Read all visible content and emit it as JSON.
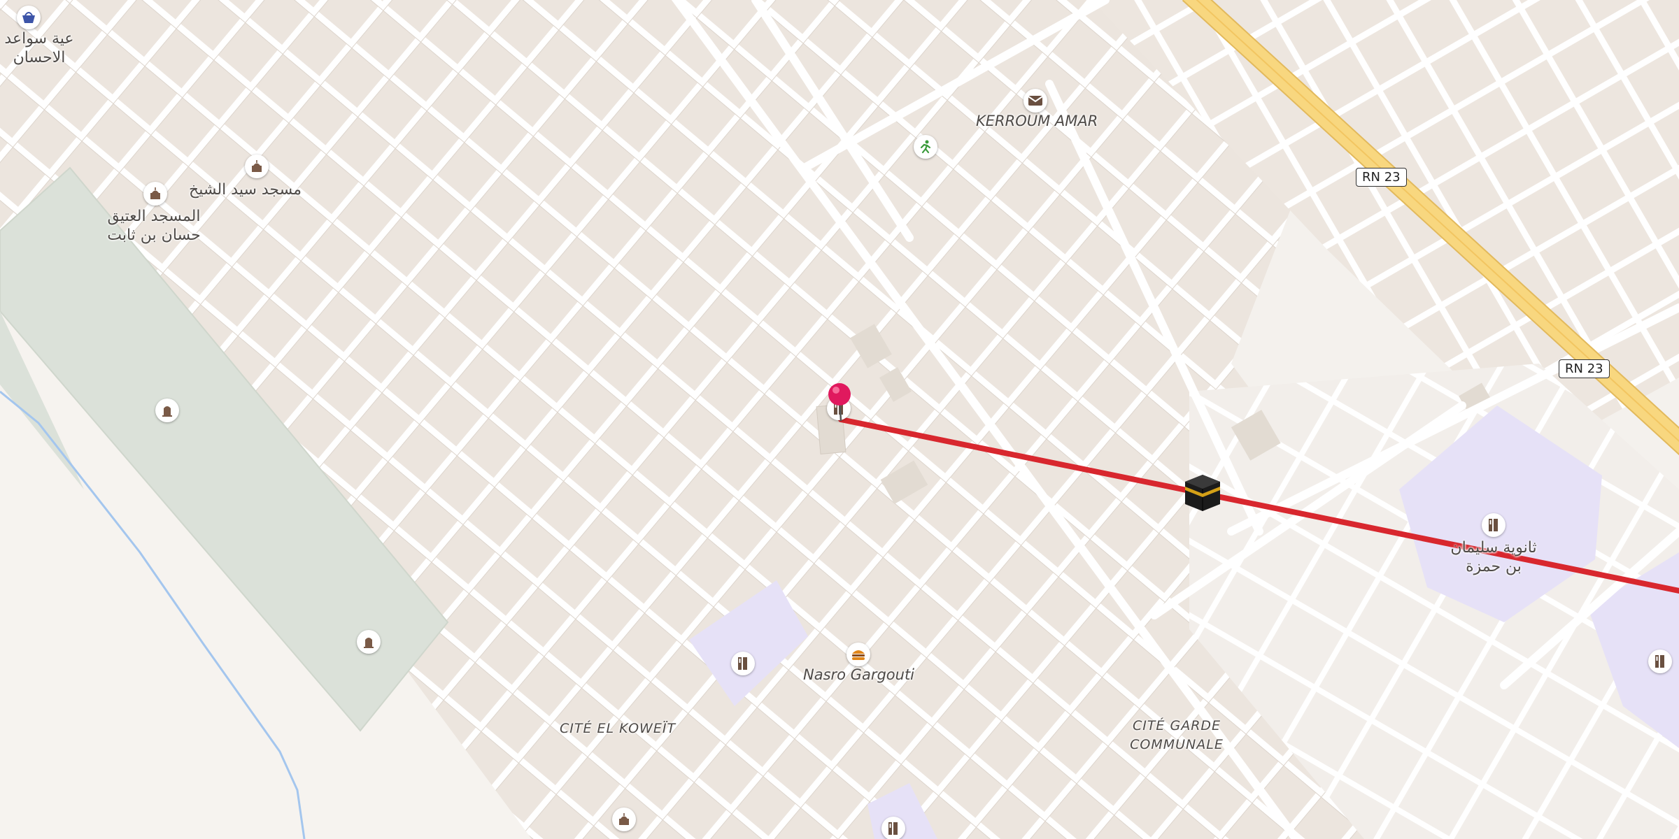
{
  "map": {
    "place_labels": {
      "kerroum_amar": "KERROUM AMAR",
      "nasro_gargouti": "Nasro Gargouti",
      "cite_el_koweit": "CITÉ EL KOWEÏT",
      "cite_garde_1": "CITÉ GARDE",
      "cite_garde_2": "COMMUNALE",
      "mosque_sidi_line1": "مسجد سيد الشيخ",
      "mosque_atiq_line1": "المسجد العتيق",
      "mosque_atiq_line2": "حسان بن ثابت",
      "shop_line1": "عية سواعد",
      "shop_line2": "الاحسان",
      "school_line1": "ثانوية سليمان",
      "school_line2": "بن حمزة"
    },
    "road_shields": {
      "rn23_a": "RN 23",
      "rn23_b": "RN 23"
    },
    "icons": {
      "post": "envelope-icon",
      "sport": "runner-icon",
      "mosque": "mosque-icon",
      "cemetery": "tombstone-icon",
      "fast_food": "burger-icon",
      "school": "school-icon",
      "shop": "basket-icon",
      "pin": "location-pin-icon",
      "qibla": "kaaba-icon"
    },
    "colors": {
      "background": "#f4f1ed",
      "block": "#ece5de",
      "road": "#ffffff",
      "road_edge": "#dcd4cc",
      "highway": "#f8d77f",
      "highway_edge": "#e2b95c",
      "park": "#dbe1d9",
      "school_area": "#e6e1f7",
      "qibla_line": "#d8272e",
      "pin": "#e0195e",
      "river": "#a4c6ee",
      "poi_brown": "#7a5a47",
      "poi_orange": "#e1861a",
      "poi_green": "#3a9a3a",
      "poi_blue": "#3c54a8"
    }
  }
}
